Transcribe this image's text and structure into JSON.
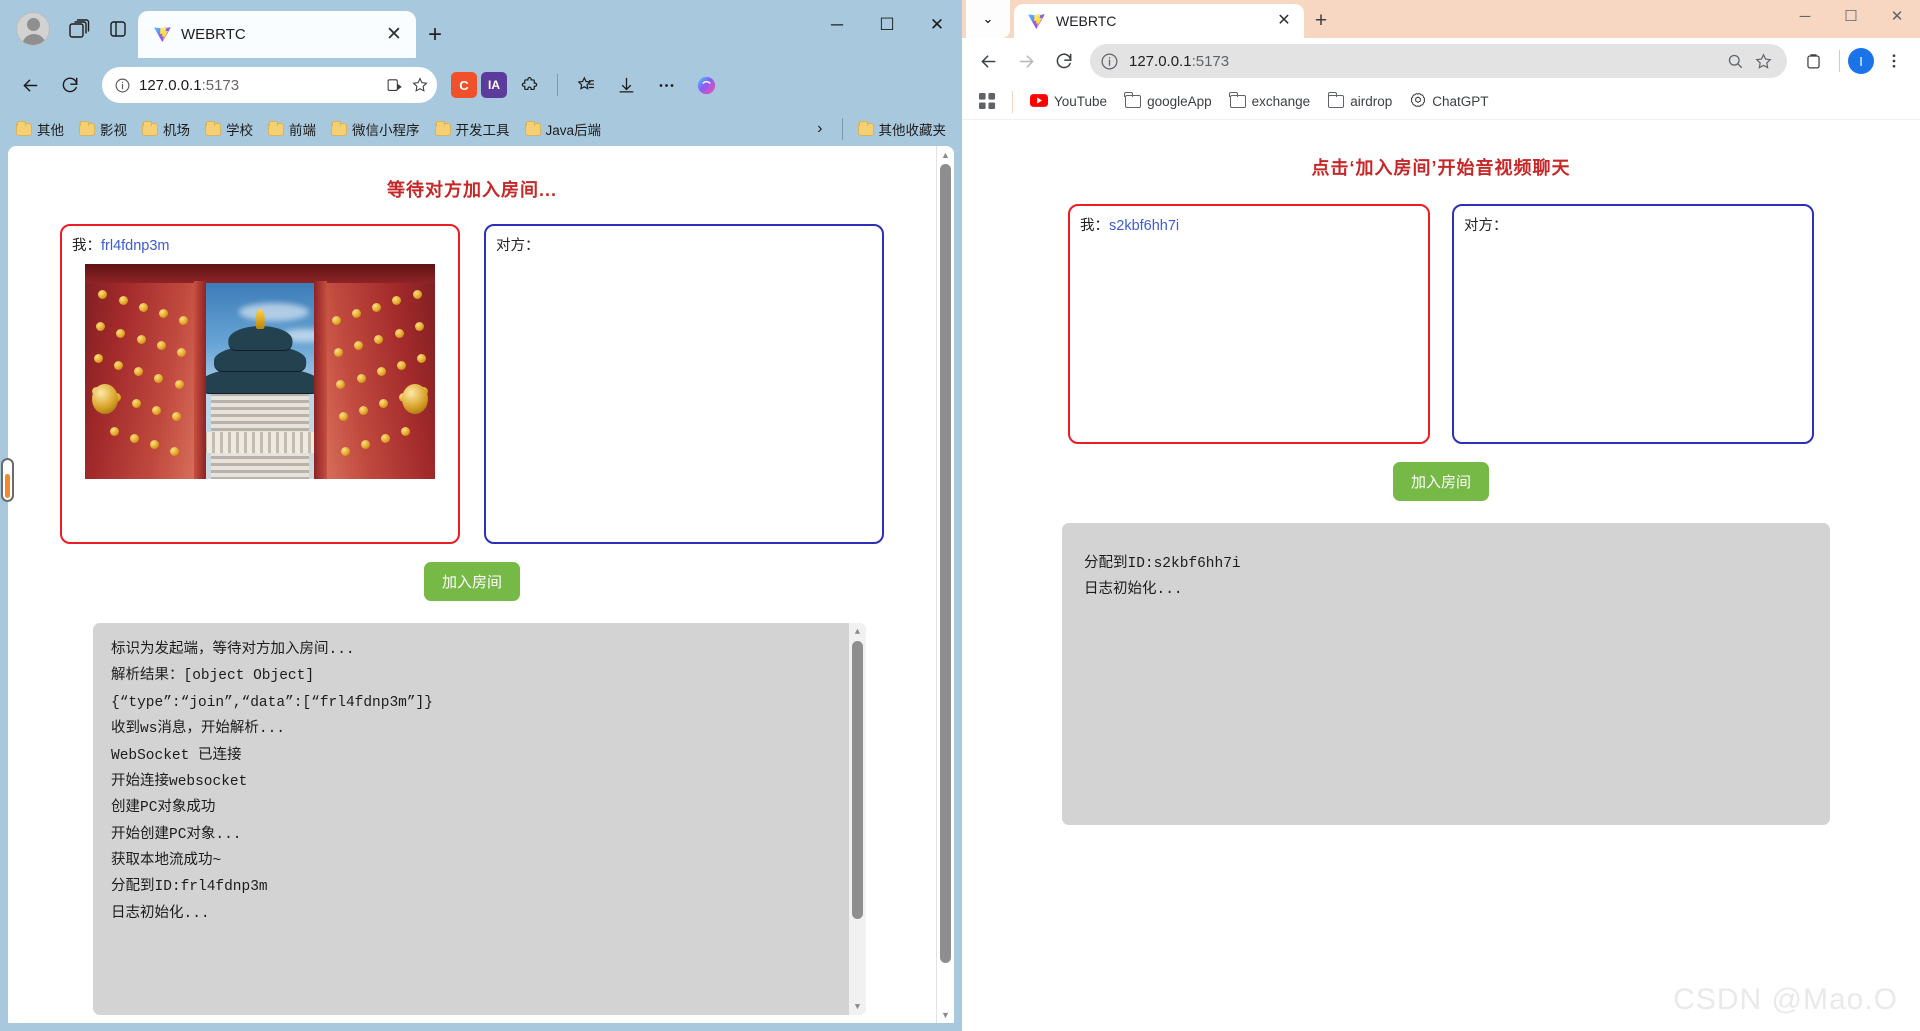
{
  "left_window": {
    "browser": "edge",
    "tab": {
      "title": "WEBRTC",
      "close_label": "✕"
    },
    "newtab_label": "+",
    "window_controls": {
      "minimize": "─",
      "maximize": "☐",
      "close": "✕"
    },
    "omnibox": {
      "host": "127.0.0.1",
      "port": ":5173",
      "info_icon": "ⓘ"
    },
    "extensions": [
      {
        "name": "c-extension",
        "label": "C",
        "color": "#f0502a"
      },
      {
        "name": "ia-extension",
        "label": "IA",
        "color": "#5b3b9c"
      }
    ],
    "bookmarks": [
      {
        "label": "其他"
      },
      {
        "label": "影视"
      },
      {
        "label": "机场"
      },
      {
        "label": "学校"
      },
      {
        "label": "前端"
      },
      {
        "label": "微信小程序"
      },
      {
        "label": "开发工具"
      },
      {
        "label": "Java后端"
      }
    ],
    "bookmarks_overflow": "›",
    "other_bookmarks": "其他收藏夹",
    "page": {
      "title": "等待对方加入房间...",
      "me_label": "我：",
      "me_id": "frl4fdnp3m",
      "peer_label": "对方：",
      "join_button": "加入房间",
      "log_lines": [
        "标识为发起端，等待对方加入房间...",
        "解析结果：[object Object]",
        "{“type”:“join”,“data”:[“frl4fdnp3m”]}",
        "收到ws消息，开始解析...",
        "WebSocket 已连接",
        "开始连接websocket",
        "创建PC对象成功",
        "开始创建PC对象...",
        "获取本地流成功~",
        "分配到ID:frl4fdnp3m",
        "日志初始化..."
      ]
    }
  },
  "right_window": {
    "browser": "chrome",
    "tabsearch_icon": "⌄",
    "tab": {
      "title": "WEBRTC",
      "close_label": "✕"
    },
    "newtab_label": "+",
    "window_controls": {
      "minimize": "─",
      "maximize": "☐",
      "close": "✕"
    },
    "omnibox": {
      "host": "127.0.0.1",
      "port": ":5173",
      "info_icon": "ⓘ"
    },
    "avatar_letter": "I",
    "bookmarks": [
      {
        "label": "YouTube",
        "icon": "youtube-icon"
      },
      {
        "label": "googleApp",
        "icon": "folder-icon"
      },
      {
        "label": "exchange",
        "icon": "folder-icon"
      },
      {
        "label": "airdrop",
        "icon": "folder-icon"
      },
      {
        "label": "ChatGPT",
        "icon": "chatgpt-icon"
      }
    ],
    "page": {
      "title": "点击‘加入房间’开始音视频聊天",
      "me_label": "我：",
      "me_id": "s2kbf6hh7i",
      "peer_label": "对方：",
      "join_button": "加入房间",
      "log_lines": [
        "分配到ID:s2kbf6hh7i",
        "日志初始化..."
      ]
    }
  },
  "watermark": "CSDN @Mao.O",
  "colors": {
    "edge_chrome_bg": "#a8c8dd",
    "chrome_tabstrip_bg": "#f8d7c2",
    "title_red": "#c62828",
    "me_border": "#ec1c24",
    "peer_border": "#2d2fbb",
    "join_green": "#76b947",
    "log_gray": "#d3d3d3",
    "id_blue": "#3b5bd4"
  }
}
